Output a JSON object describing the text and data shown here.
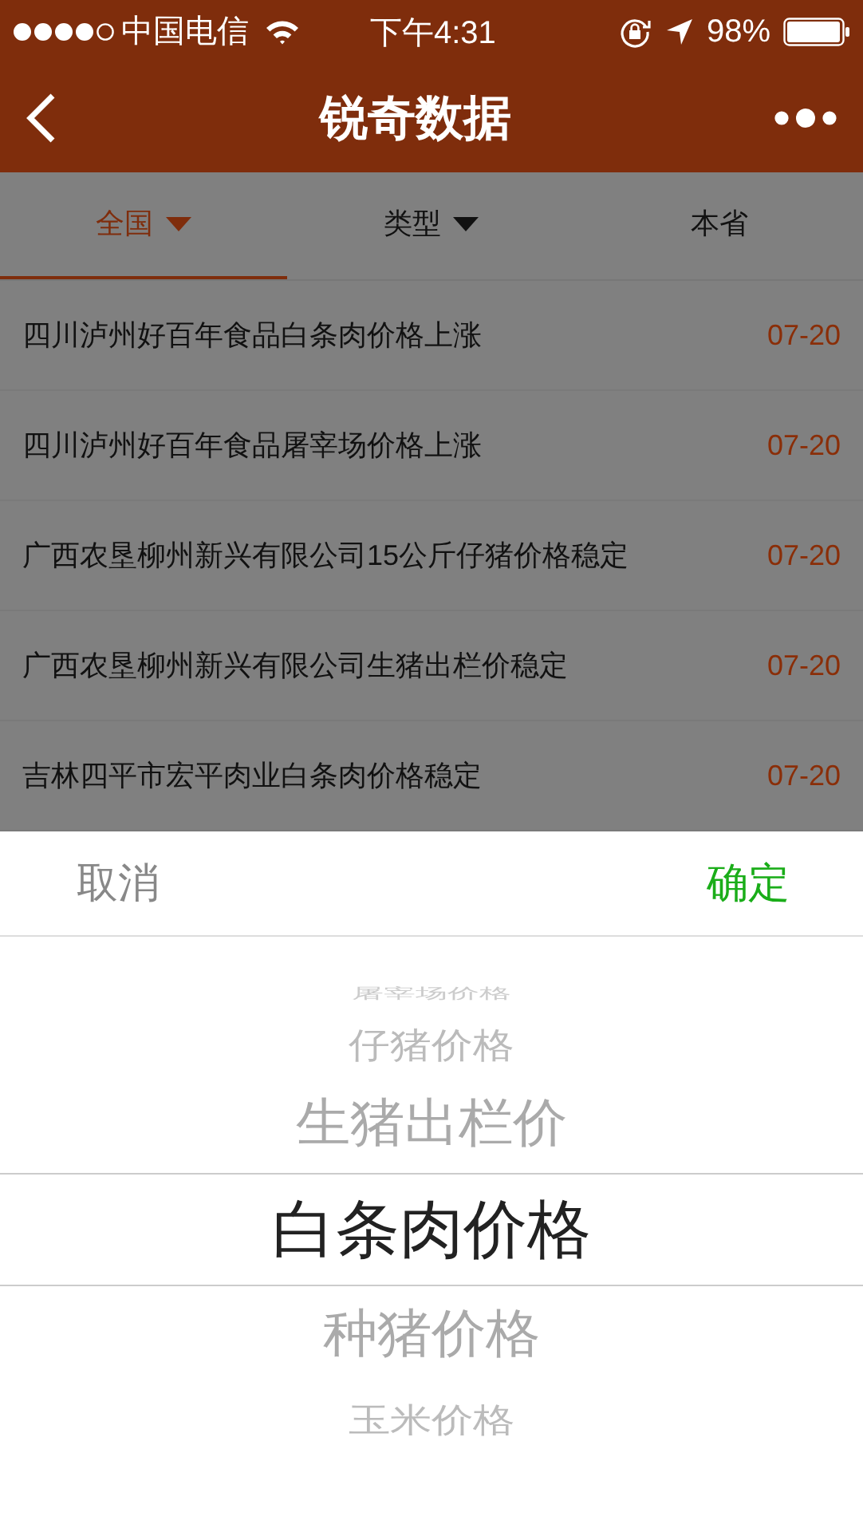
{
  "status_bar": {
    "carrier": "中国电信",
    "time": "下午4:31",
    "battery": "98%"
  },
  "nav": {
    "title": "锐奇数据"
  },
  "tabs": [
    {
      "label": "全国",
      "selected": true,
      "dropdown": true
    },
    {
      "label": "类型",
      "selected": false,
      "dropdown": true
    },
    {
      "label": "本省",
      "selected": false,
      "dropdown": false
    }
  ],
  "news": [
    {
      "title": "四川泸州好百年食品白条肉价格上涨",
      "date": "07-20"
    },
    {
      "title": "四川泸州好百年食品屠宰场价格上涨",
      "date": "07-20"
    },
    {
      "title": "广西农垦柳州新兴有限公司15公斤仔猪价格稳定",
      "date": "07-20"
    },
    {
      "title": "广西农垦柳州新兴有限公司生猪出栏价稳定",
      "date": "07-20"
    },
    {
      "title": "吉林四平市宏平肉业白条肉价格稳定",
      "date": "07-20"
    }
  ],
  "picker": {
    "cancel": "取消",
    "confirm": "确定",
    "options": [
      {
        "label": "屠宰场价格",
        "selected": false
      },
      {
        "label": "仔猪价格",
        "selected": false
      },
      {
        "label": "生猪出栏价",
        "selected": false
      },
      {
        "label": "白条肉价格",
        "selected": true
      },
      {
        "label": "种猪价格",
        "selected": false
      },
      {
        "label": "玉米价格",
        "selected": false
      }
    ]
  }
}
